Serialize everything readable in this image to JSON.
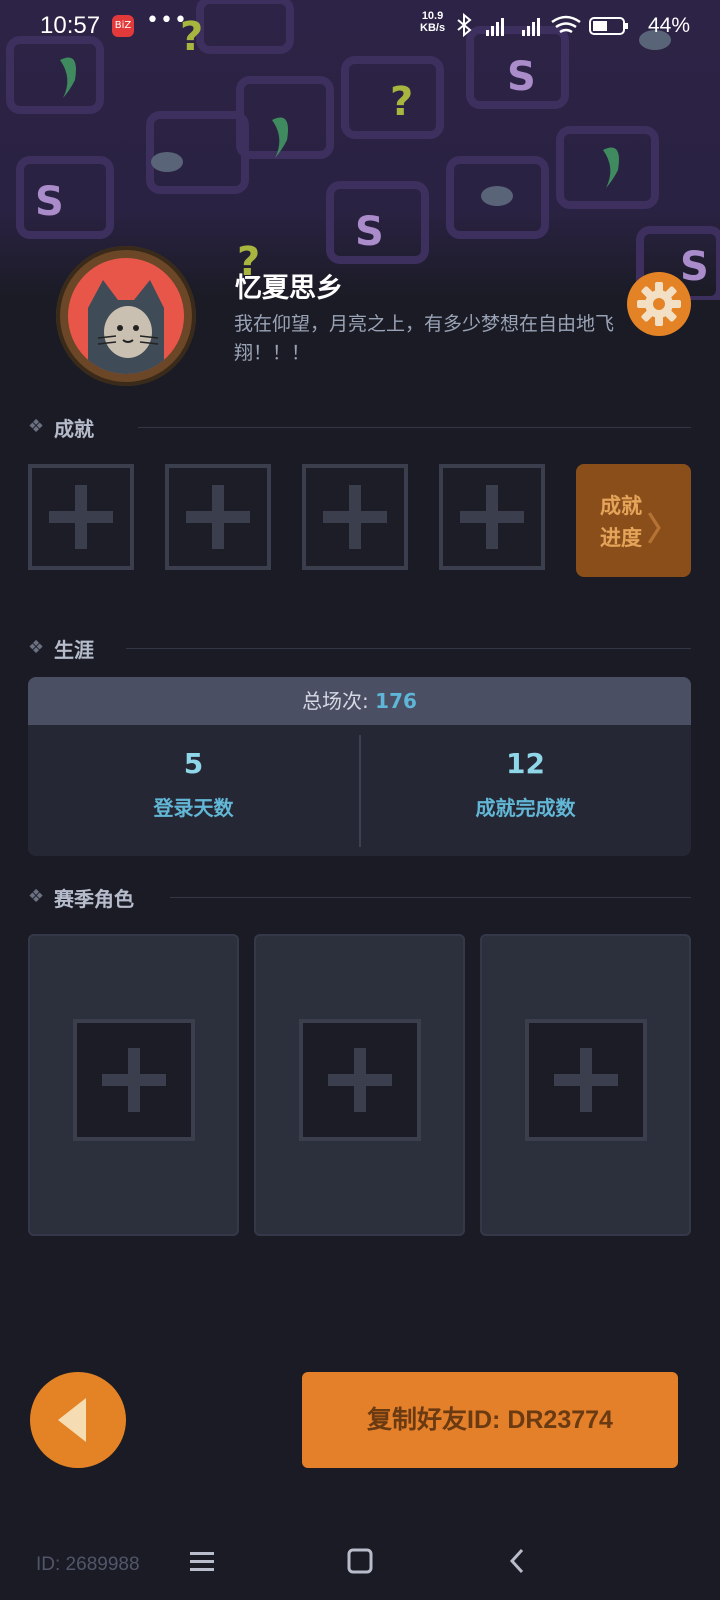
{
  "status_bar": {
    "time": "10:57",
    "app_badge": "BiZ",
    "more": "•••",
    "net_speed_value": "10.9",
    "net_speed_unit": "KB/s",
    "battery": "44%"
  },
  "profile": {
    "name": "忆夏思乡",
    "bio": "我在仰望，月亮之上，有多少梦想在自由地飞翔！！！"
  },
  "sections": {
    "achievements": "成就",
    "career": "生涯",
    "season_characters": "赛季角色"
  },
  "achievement_progress": {
    "line1": "成就",
    "line2": "进度",
    "arrow": "〉"
  },
  "career": {
    "total_label": "总场次: ",
    "total_value": "176",
    "stats": [
      {
        "value": "5",
        "label": "登录天数"
      },
      {
        "value": "12",
        "label": "成就完成数"
      }
    ]
  },
  "buttons": {
    "copy_friend_id": "复制好友ID: DR23774"
  },
  "footer": {
    "id": "ID: 2689988"
  },
  "colors": {
    "accent": "#e48325",
    "background": "#1a1b24",
    "career_value": "#8fd6e8"
  }
}
